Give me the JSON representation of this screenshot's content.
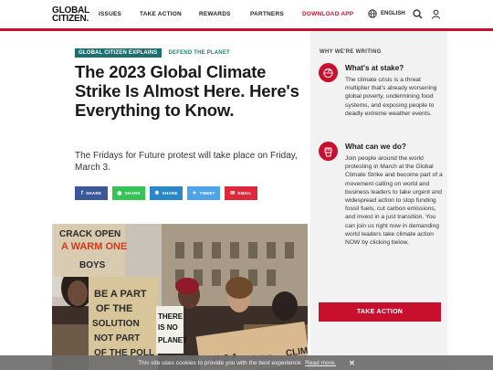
{
  "header": {
    "logo_line1": "GLOBAL",
    "logo_line2": "CITIZEN.",
    "nav": [
      "ISSUES",
      "TAKE ACTION",
      "REWARDS",
      "PARTNERS"
    ],
    "download": "DOWNLOAD APP",
    "language": "ENGLISH",
    "icons": [
      "globe-icon",
      "search-icon",
      "user-icon"
    ]
  },
  "article": {
    "tag_primary": "GLOBAL CITIZEN EXPLAINS",
    "tag_secondary": "DEFEND THE PLANET",
    "title": "The 2023 Global Climate Strike Is Almost Here. Here's Everything to Know.",
    "subtitle": "The Fridays for Future protest will take place on Friday, March 3.",
    "share_buttons": [
      {
        "label": "SHARE",
        "icon": "facebook-icon",
        "color": "#3b5998"
      },
      {
        "label": "SHARE",
        "icon": "whatsapp-icon",
        "color": "#35c456"
      },
      {
        "label": "SHARE",
        "icon": "share-icon",
        "color": "#2a88c9"
      },
      {
        "label": "TWEET",
        "icon": "twitter-icon",
        "color": "#4ea4e8"
      },
      {
        "label": "EMAIL",
        "icon": "email-icon",
        "color": "#e0283c"
      }
    ],
    "photo_signs": [
      "CRACK OPEN A WARM ONE",
      "BE A PART OF THE SOLUTION NOT PART OF THE POLLUTION",
      "THERE IS NO PLANET B",
      "IT'S A SOLUTION",
      "CLIMA"
    ]
  },
  "sidebar": {
    "heading": "WHY WE'RE WRITING",
    "items": [
      {
        "title": "What's at stake?",
        "body": "The climate crisis is a threat multiplier that's already worsening global poverty, undermining food systems, and exposing people to deadly extreme weather events.",
        "icon": "globe-fire-icon"
      },
      {
        "title": "What can we do?",
        "body": "Join people around the world protesting in March at the Global Climate Strike and become part of a movement calling on world and business leaders to take urgent and widespread action to stop funding fossil fuels, cut carbon emissions, and invest in a just transition. You can join us right now in demanding world leaders take climate action NOW by clicking below.",
        "icon": "raised-fist-icon"
      }
    ],
    "cta": "TAKE ACTION"
  },
  "cookie": {
    "text": "This site uses cookies to provide you with the best experience.",
    "link": "Read more.",
    "close": "✕"
  },
  "colors": {
    "brand_red": "#c8102e",
    "tag_teal": "#1e6f6f"
  }
}
